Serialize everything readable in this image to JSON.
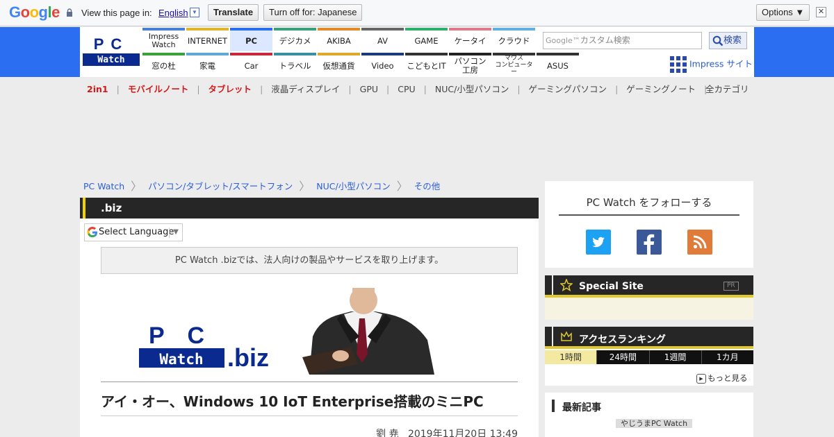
{
  "translate_bar": {
    "google_logo": "Google",
    "view_text": "View this page in:",
    "language": "English",
    "translate_label": "Translate",
    "turn_off_label": "Turn off for: Japanese",
    "options_label": "Options ▼",
    "close_label": "✕"
  },
  "header": {
    "logo_top": "PC",
    "logo_bottom": "Watch",
    "nav_top": [
      {
        "label": "Impress Watch",
        "color": "#4a7fd8"
      },
      {
        "label": "INTERNET",
        "color": "#e0b52b"
      },
      {
        "label": "PC",
        "color": "#2b6ef2",
        "active": true
      },
      {
        "label": "デジカメ",
        "color": "#3ba07a"
      },
      {
        "label": "AKIBA",
        "color": "#e58a2a"
      },
      {
        "label": "AV",
        "color": "#666666"
      },
      {
        "label": "GAME",
        "color": "#2fb06f"
      },
      {
        "label": "ケータイ",
        "color": "#e07a8a"
      },
      {
        "label": "クラウド",
        "color": "#5fb0e0"
      }
    ],
    "nav_bottom": [
      {
        "label": "窓の杜",
        "color": "#3aa03a"
      },
      {
        "label": "家電",
        "color": "#5fa8d8"
      },
      {
        "label": "Car",
        "color": "#c8283a"
      },
      {
        "label": "トラベル",
        "color": "#3a8fa0"
      },
      {
        "label": "仮想通貨",
        "color": "#e0a82a"
      },
      {
        "label": "Video",
        "color": "#1a3a7a"
      },
      {
        "label": "こどもとIT",
        "color": "#333333"
      },
      {
        "label": "パソコン工房",
        "color": "#222222"
      },
      {
        "label": "マウスコンピューター",
        "color": "#333333"
      },
      {
        "label": "ASUS",
        "color": "#333333"
      }
    ],
    "search_placeholder_prefix": "Google™",
    "search_placeholder": "カスタム検索",
    "search_button": "検索",
    "impress_link": "Impress サイト"
  },
  "subnav": {
    "items": [
      {
        "label": "2in1",
        "hot": true
      },
      {
        "label": "モバイルノート",
        "hot": true
      },
      {
        "label": "タブレット",
        "hot": true
      },
      {
        "label": "液晶ディスプレイ",
        "hot": false
      },
      {
        "label": "GPU",
        "hot": false
      },
      {
        "label": "CPU",
        "hot": false
      },
      {
        "label": "NUC/小型パソコン",
        "hot": false
      },
      {
        "label": "ゲーミングパソコン",
        "hot": false
      },
      {
        "label": "ゲーミングノート",
        "hot": false
      }
    ],
    "all_categories": "全カテゴリ"
  },
  "breadcrumb": [
    "PC Watch",
    "パソコン/タブレット/スマートフォン",
    "NUC/小型パソコン",
    "その他"
  ],
  "main": {
    "category_title": ".biz",
    "select_language": "Select Language",
    "biz_note": "PC Watch .bizでは、法人向けの製品やサービスを取り上げます。",
    "banner_pc": "P C",
    "banner_watch": "Watch",
    "banner_biz": ".biz",
    "article_title": "アイ・オー、Windows 10 IoT Enterprise搭載のミニPC",
    "author": "劉 尭",
    "date": "2019年11月20日 13:49"
  },
  "sidebar": {
    "follow_title": "PC Watch をフォローする",
    "special_site": "Special Site",
    "pr": "PR",
    "access_ranking": "アクセスランキング",
    "rank_tabs": [
      "1時間",
      "24時間",
      "1週間",
      "1カ月"
    ],
    "more": "もっと見る",
    "latest_title": "最新記事",
    "latest_tag": "やじうまPC Watch"
  },
  "colors": {
    "brand_blue": "#2b6ef2",
    "twitter": "#1da1f2",
    "facebook": "#3b5998",
    "rss": "#e07b39",
    "accent_yellow": "#e1c82d"
  }
}
